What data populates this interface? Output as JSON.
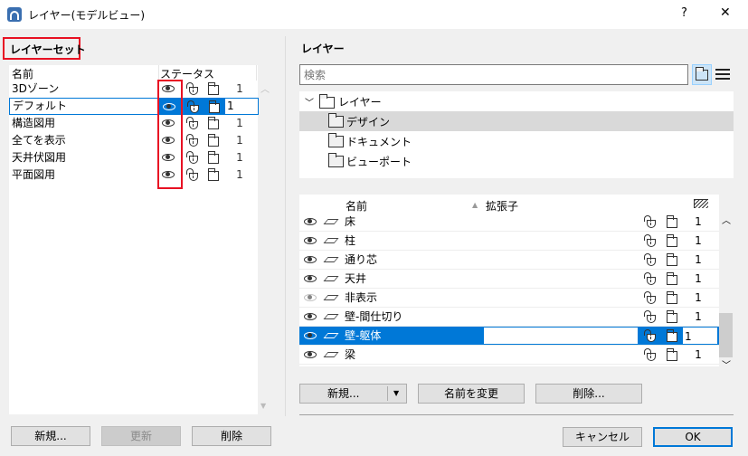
{
  "window": {
    "title": "レイヤー(モデルビュー)",
    "help": "?",
    "close": "✕"
  },
  "left": {
    "heading": "レイヤーセット",
    "columns": {
      "name": "名前",
      "status": "ステータス"
    },
    "rows": [
      {
        "name": "3Dゾーン",
        "num": "1"
      },
      {
        "name": "デフォルト",
        "num": "1",
        "selected": true
      },
      {
        "name": "構造図用",
        "num": "1"
      },
      {
        "name": "全てを表示",
        "num": "1"
      },
      {
        "name": "天井伏図用",
        "num": "1"
      },
      {
        "name": "平面図用",
        "num": "1"
      }
    ],
    "buttons": {
      "new": "新規...",
      "update": "更新",
      "delete": "削除"
    }
  },
  "right": {
    "heading": "レイヤー",
    "search_placeholder": "検索",
    "tree": {
      "root": "レイヤー",
      "items": [
        "デザイン",
        "ドキュメント",
        "ビューポート"
      ]
    },
    "columns": {
      "name": "名前",
      "ext": "拡張子"
    },
    "rows": [
      {
        "name": "床",
        "num": "1",
        "visible": true
      },
      {
        "name": "柱",
        "num": "1",
        "visible": true
      },
      {
        "name": "通り芯",
        "num": "1",
        "visible": true
      },
      {
        "name": "天井",
        "num": "1",
        "visible": true
      },
      {
        "name": "非表示",
        "num": "1",
        "visible": false
      },
      {
        "name": "壁-間仕切り",
        "num": "1",
        "visible": true
      },
      {
        "name": "壁-躯体",
        "num": "1",
        "visible": true,
        "selected": true
      },
      {
        "name": "梁",
        "num": "1",
        "visible": true
      }
    ],
    "buttons": {
      "new": "新規...",
      "rename": "名前を変更",
      "delete": "削除..."
    }
  },
  "footer": {
    "cancel": "キャンセル",
    "ok": "OK"
  },
  "colors": {
    "accent": "#0078d7",
    "highlight_box": "#e81123"
  }
}
